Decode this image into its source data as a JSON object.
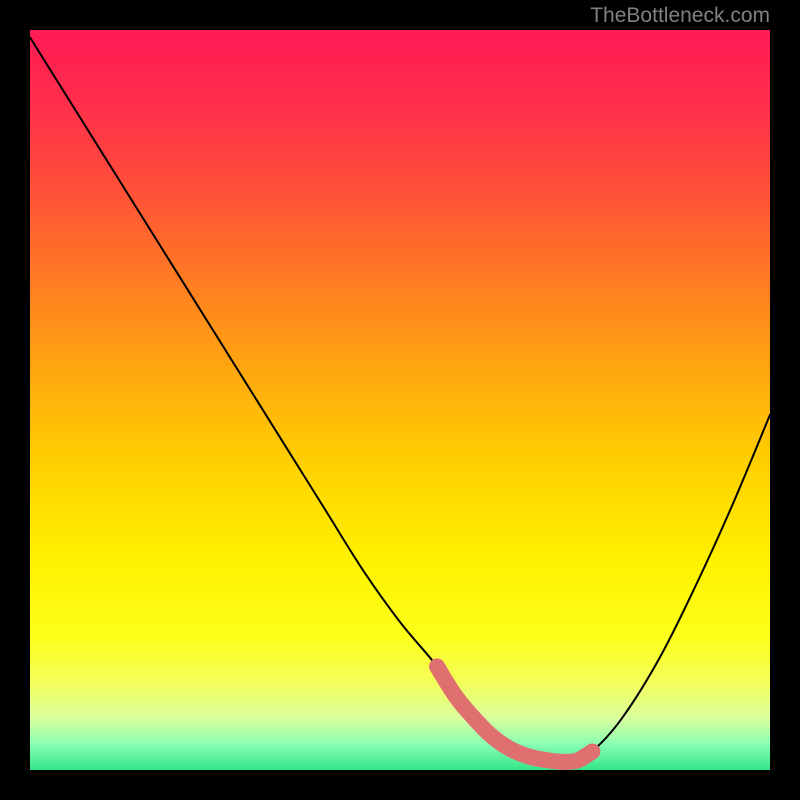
{
  "watermark": "TheBottleneck.com",
  "gradient": {
    "stops": [
      {
        "offset": 0.0,
        "color": "#ff1a55"
      },
      {
        "offset": 0.1,
        "color": "#ff2e4b"
      },
      {
        "offset": 0.22,
        "color": "#ff5138"
      },
      {
        "offset": 0.35,
        "color": "#ff8020"
      },
      {
        "offset": 0.48,
        "color": "#ffae0c"
      },
      {
        "offset": 0.6,
        "color": "#ffd400"
      },
      {
        "offset": 0.72,
        "color": "#fff200"
      },
      {
        "offset": 0.82,
        "color": "#fdff1a"
      },
      {
        "offset": 0.88,
        "color": "#f4ff59"
      },
      {
        "offset": 0.93,
        "color": "#d9ff9e"
      },
      {
        "offset": 0.965,
        "color": "#8affb3"
      },
      {
        "offset": 1.0,
        "color": "#34e58a"
      }
    ]
  },
  "chart_data": {
    "type": "line",
    "title": "",
    "xlabel": "",
    "ylabel": "",
    "xlim": [
      0,
      100
    ],
    "ylim": [
      0,
      100
    ],
    "series": [
      {
        "name": "bottleneck-curve",
        "color": "#000000",
        "x": [
          0,
          5,
          10,
          15,
          20,
          25,
          30,
          35,
          40,
          45,
          50,
          55,
          57.5,
          60,
          62.5,
          65,
          67.5,
          70,
          72,
          74,
          76,
          80,
          85,
          90,
          95,
          100
        ],
        "y": [
          99,
          91,
          83,
          75,
          67,
          59,
          51,
          43,
          35,
          27,
          20,
          14,
          10,
          7,
          4.5,
          2.8,
          1.8,
          1.3,
          1.1,
          1.3,
          2.5,
          7,
          15,
          25,
          36,
          48
        ]
      },
      {
        "name": "optimal-range-highlight",
        "color": "#e07070",
        "x": [
          55,
          57.5,
          60,
          62.5,
          65,
          67.5,
          70,
          72,
          74,
          76
        ],
        "y": [
          14,
          10,
          7,
          4.5,
          2.8,
          1.8,
          1.3,
          1.1,
          1.3,
          2.5
        ]
      }
    ]
  }
}
